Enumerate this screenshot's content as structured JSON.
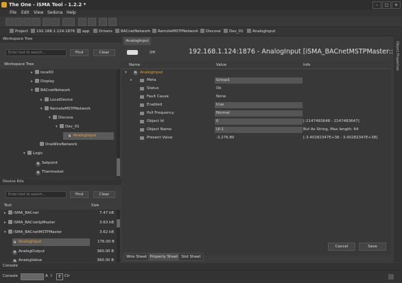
{
  "window": {
    "title": "The One - iSMA Tool - 1.2.2 *",
    "controls": [
      "–",
      "□",
      "✕"
    ]
  },
  "menu": [
    "File",
    "Edit",
    "View",
    "Sedona",
    "Help"
  ],
  "breadcrumb": [
    "Project",
    "192.168.1.124:1876",
    "app",
    "Drivers",
    "BACnetNetwork",
    "RemoteMSTPNetwork",
    "Discove",
    "Dev_01",
    "AnalogInput"
  ],
  "workspace": {
    "title": "Workspace Tree",
    "search_placeholder": "Enter text to search...",
    "find": "Find",
    "clear": "Clear",
    "tree_label": "Workspace Tree",
    "nodes": [
      {
        "label": "localIO",
        "arrow": "▸"
      },
      {
        "label": "Display",
        "arrow": "▸"
      },
      {
        "label": "BACnetNetwork",
        "arrow": "▾"
      },
      {
        "label": "LocalDevice",
        "arrow": "▸"
      },
      {
        "label": "RemoteMSTPNetwork",
        "arrow": "▾"
      },
      {
        "label": "Discove",
        "arrow": "▾"
      },
      {
        "label": "Dev_01",
        "arrow": "▾"
      },
      {
        "label": "AnalogInput",
        "arrow": ""
      },
      {
        "label": "OneWireNetwork",
        "arrow": ""
      },
      {
        "label": "Logic",
        "arrow": "▾"
      },
      {
        "label": "Setpoint",
        "arrow": ""
      },
      {
        "label": "Thermostat",
        "arrow": ""
      }
    ]
  },
  "kits": {
    "title": "Device Kits",
    "search_placeholder": "Enter text to search...",
    "find": "Find",
    "clear": "Clear",
    "col_text": "Text",
    "col_size": "Size",
    "rows": [
      {
        "label": "iSMA_BACnet",
        "size": "7.47 kB"
      },
      {
        "label": "iSMA_BACnetIpMaster",
        "size": "3.63 kB"
      },
      {
        "label": "iSMA_BACnetMSTPMaster",
        "size": "3.62 kB"
      },
      {
        "label": "AnalogInput",
        "size": "176.00 B"
      },
      {
        "label": "AnalogOutput",
        "size": "360.00 B"
      },
      {
        "label": "AnalogValue",
        "size": "360.00 B"
      }
    ]
  },
  "editor": {
    "tab": "AnalogInput",
    "toggle_label": "Off",
    "heading": "192.168.1.124:1876 - AnalogInput [iSMA_BACnetMSTPMaster::AnalogIn",
    "col_name": "Name",
    "col_value": "Value",
    "col_info": "Info",
    "root": "AnalogInput",
    "props": [
      {
        "name": "Meta",
        "value": "Group1",
        "info": ""
      },
      {
        "name": "Status",
        "value": "Ok",
        "info": ""
      },
      {
        "name": "Fault Cause",
        "value": "None",
        "info": ""
      },
      {
        "name": "Enabled",
        "value": "true",
        "info": ""
      },
      {
        "name": "Poll Frequency",
        "value": "Normal",
        "info": ""
      },
      {
        "name": "Object Id",
        "value": "0",
        "info": "[-2147483648 - 2147483647]"
      },
      {
        "name": "Object Name",
        "value": "UI-1",
        "info": "Buf As String, Max length: 64"
      },
      {
        "name": "Present Value",
        "value": "-3,276.80",
        "info": "[-3.40282347E+38 - 3.40282347E+38]"
      }
    ],
    "cancel": "Cancel",
    "save": "Save",
    "bottom_tabs": [
      "Wire Sheet",
      "Property Sheet",
      "Slot Sheet"
    ]
  },
  "right_panel": "Object Properties",
  "console": {
    "title": "Console",
    "label": "Console",
    "btn_a": "A",
    "btn_i": "I",
    "btn_e": "E",
    "btn_clr": "Clr"
  }
}
